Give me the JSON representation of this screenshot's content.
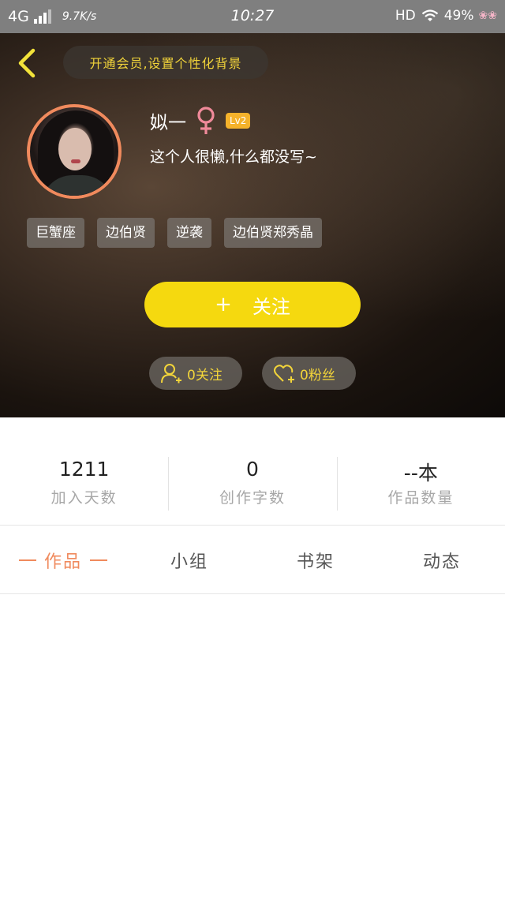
{
  "status_bar": {
    "network": "4G",
    "speed": "9.7K/s",
    "time": "10:27",
    "hd": "HD",
    "battery": "49%"
  },
  "header": {
    "vip_banner": "开通会员,设置个性化背景",
    "username": "姒一",
    "level": "Lv2",
    "bio": "这个人很懒,什么都没写~",
    "tags": [
      "巨蟹座",
      "边伯贤",
      "逆袭",
      "边伯贤郑秀晶"
    ],
    "follow_button": {
      "icon": "+",
      "label": "关注"
    },
    "following_label": "0关注",
    "fans_label": "0粉丝"
  },
  "stats": [
    {
      "value": "1211",
      "label": "加入天数"
    },
    {
      "value": "0",
      "label": "创作字数"
    },
    {
      "value": "--本",
      "label": "作品数量"
    }
  ],
  "tabs": [
    {
      "label": "作品",
      "active": true
    },
    {
      "label": "小组",
      "active": false
    },
    {
      "label": "书架",
      "active": false
    },
    {
      "label": "动态",
      "active": false
    }
  ],
  "colors": {
    "accent": "#f08a5d",
    "follow_button": "#f5d90f",
    "vip_text": "#f2d43a",
    "level_badge": "#f5b22b",
    "gender_icon": "#f08a9a"
  }
}
